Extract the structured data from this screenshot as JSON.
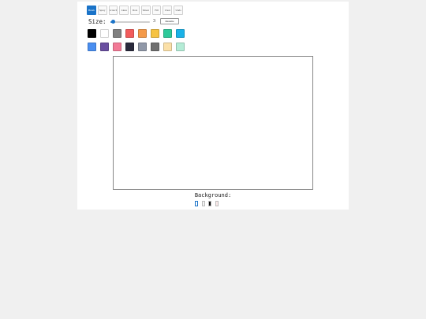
{
  "toolbar": {
    "tools": [
      {
        "label": "Brush",
        "active": true
      },
      {
        "label": "Spray",
        "active": false
      },
      {
        "label": "Scratch",
        "active": false
      },
      {
        "label": "Lines",
        "active": false
      },
      {
        "label": "Dots",
        "active": false
      },
      {
        "label": "Smear",
        "active": false
      },
      {
        "label": "Fill",
        "active": false
      },
      {
        "label": "Clear",
        "active": false
      },
      {
        "label": "Undo",
        "active": false
      }
    ]
  },
  "size": {
    "label": "Size:",
    "value": "3",
    "value_num": 3,
    "min": 1,
    "max": 30,
    "reset_label": "Resume"
  },
  "palette": {
    "row1": [
      "#000000",
      "#ffffff",
      "#808080",
      "#f25c5c",
      "#f49a4a",
      "#f6c342",
      "#2ec99a",
      "#1ab2e8"
    ],
    "row2": [
      "#4a8ef0",
      "#6a4fa0",
      "#f27a96",
      "#2a2a3c",
      "#9098a8",
      "#707070",
      "#fbe0a8",
      "#b4ecd6"
    ]
  },
  "background": {
    "label": "Background:",
    "options": [
      {
        "color": "#ffffff",
        "selected": true
      },
      {
        "color": "#f3f3f3",
        "selected": false
      },
      {
        "color": "#111111",
        "selected": false
      },
      {
        "color": "#fbeaea",
        "selected": false
      }
    ]
  }
}
